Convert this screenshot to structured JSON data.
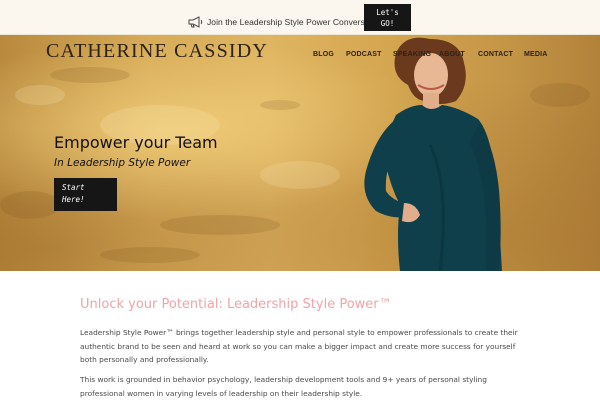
{
  "topbar": {
    "icon": "megaphone-icon",
    "announcement": "Join the Leadership Style Power Conversation!",
    "cta_line1": "Let's",
    "cta_line2": "GO!"
  },
  "header": {
    "logo": "CATHERINE CASSIDY",
    "nav": [
      "BLOG",
      "PODCAST",
      "SPEAKING",
      "ABOUT",
      "CONTACT",
      "MEDIA"
    ]
  },
  "hero": {
    "headline": "Empower your Team",
    "subheadline": "In Leadership Style Power",
    "cta_line1": "Start",
    "cta_line2": "Here!"
  },
  "main": {
    "heading": "Unlock your Potential: Leadership Style Power™",
    "paragraph1": "Leadership Style Power™ brings together leadership style and personal style to empower professionals to create their authentic brand to be seen and heard at work so you can make a bigger impact and create more success for yourself both personally and professionally.",
    "paragraph2": "This work is grounded in behavior psychology, leadership development tools and  9+ years of personal styling professional women in varying levels of leadership on their leadership style."
  },
  "colors": {
    "accent_pink": "#f1a3a8",
    "button_dark": "#161616",
    "hero_gold": "#d7ab58",
    "top_bar_bg": "#fbf7ee"
  }
}
